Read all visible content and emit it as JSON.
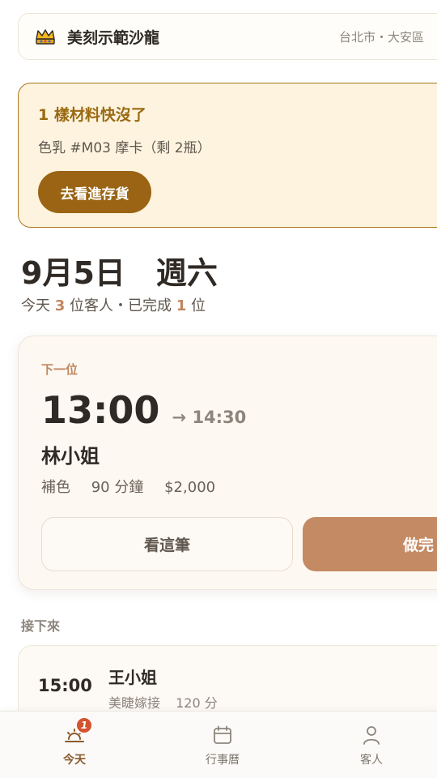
{
  "header": {
    "salon_name": "美刻示範沙龍",
    "location": "台北市・大安區"
  },
  "alert": {
    "title": "1 樣材料快沒了",
    "detail": "色乳 #M03 摩卡（剩 2瓶）",
    "button_label": "去看進存貨"
  },
  "date": {
    "day": "9月5日",
    "weekday": "週六",
    "summary_prefix": "今天",
    "clients_count": "3",
    "summary_middle": "位客人・已完成",
    "done_count": "1",
    "summary_suffix": "位"
  },
  "next_appointment": {
    "label": "下一位",
    "start_time": "13:00",
    "end_time": "→ 14:30",
    "client_name": "林小姐",
    "service": "補色",
    "duration": "90 分鐘",
    "price": "$2,000",
    "view_button": "看這筆",
    "done_button": "做完"
  },
  "upcoming": {
    "section_label": "接下來",
    "items": [
      {
        "time": "15:00",
        "client_name": "王小姐",
        "service": "美睫嫁接",
        "duration": "120 分"
      }
    ]
  },
  "bottom_nav": {
    "items": [
      {
        "label": "今天",
        "icon": "sunrise-icon",
        "badge": "1",
        "active": true
      },
      {
        "label": "行事曆",
        "icon": "calendar-icon",
        "active": false
      },
      {
        "label": "客人",
        "icon": "person-icon",
        "active": false
      }
    ]
  },
  "colors": {
    "accent": "#c48a63",
    "alert_border": "#a9771a",
    "alert_bg": "#fdf3df",
    "alert_button": "#9a6414",
    "badge": "#d4542f"
  }
}
